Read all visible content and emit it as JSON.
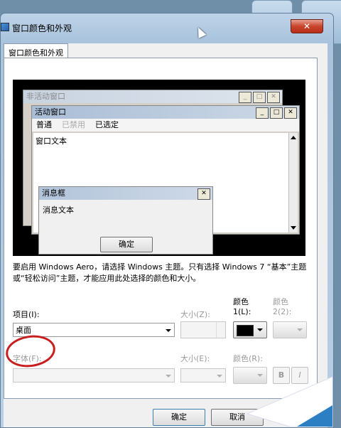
{
  "dialog": {
    "title": "窗口颜色和外观",
    "close_symbol": "✕",
    "tab_label": "窗口颜色和外观"
  },
  "preview": {
    "inactive_window_title": "非活动窗口",
    "active_window_title": "活动窗口",
    "menu": {
      "normal": "普通",
      "disabled": "已禁用",
      "selected": "已选定"
    },
    "window_text": "窗口文本",
    "message_box_title": "消息框",
    "message_text": "消息文本",
    "message_ok_button": "确定",
    "button_glyphs": {
      "minimize": "_",
      "maximize": "□",
      "close": "✕"
    }
  },
  "info_text": "要启用 Windows Aero，请选择 Windows 主题。只有选择 Windows 7 “基本”主题或“轻松访问”主题，才能应用此处选择的颜色和大小。",
  "controls": {
    "item_label": "项目(I):",
    "item_value": "桌面",
    "size_label": "大小(Z):",
    "color1_label_line1": "颜色",
    "color1_label_line2": "1(L):",
    "color2_label_line1": "颜色",
    "color2_label_line2": "2(2):",
    "color1_value": "#000000",
    "font_label": "字体(F):",
    "font_size_label": "大小(E):",
    "font_color_label": "颜色(R):",
    "bold_label": "B",
    "italic_label": "I"
  },
  "buttons": {
    "ok": "确定",
    "cancel": "取消"
  },
  "colors": {
    "highlight_circle": "#c81e1e",
    "close_button": "#c8452c"
  }
}
